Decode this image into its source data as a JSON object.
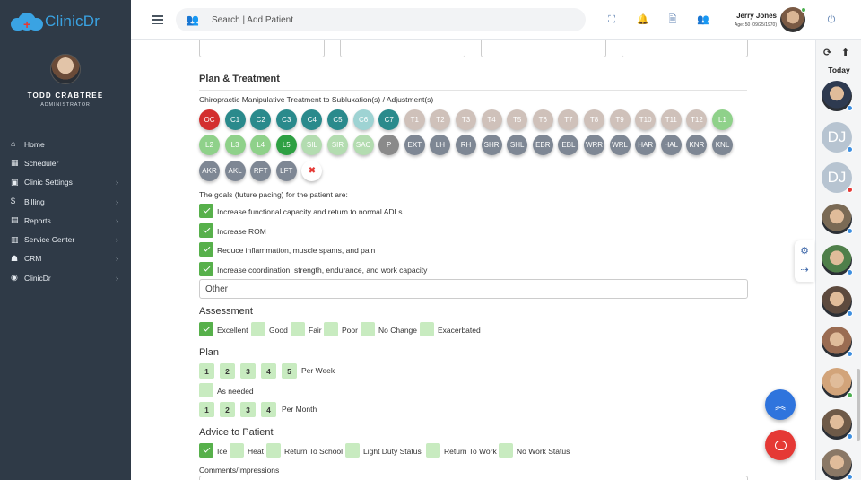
{
  "app": {
    "logo_text": "ClinicDr"
  },
  "profile": {
    "name": "TODD CRABTREE",
    "role": "ADMINISTRATOR"
  },
  "nav": [
    {
      "label": "Home",
      "icon": "home-icon",
      "chevron": false
    },
    {
      "label": "Scheduler",
      "icon": "calendar-icon",
      "chevron": false
    },
    {
      "label": "Clinic Settings",
      "icon": "settings-icon",
      "chevron": true
    },
    {
      "label": "Billing",
      "icon": "dollar-icon",
      "chevron": true
    },
    {
      "label": "Reports",
      "icon": "report-icon",
      "chevron": true
    },
    {
      "label": "Service Center",
      "icon": "service-icon",
      "chevron": true
    },
    {
      "label": "CRM",
      "icon": "crm-icon",
      "chevron": true
    },
    {
      "label": "ClinicDr",
      "icon": "clinicdr-icon",
      "chevron": true
    }
  ],
  "topbar": {
    "search_placeholder": "Search | Add Patient",
    "user_name": "Jerry Jones",
    "user_age": "Age: 50 (09/25/1970)"
  },
  "plan_treatment": {
    "title": "Plan & Treatment",
    "subtitle": "Chiropractic Manipulative Treatment to Subluxation(s) / Adjustment(s)",
    "segments_row1": [
      {
        "label": "OC",
        "color": "#d32f2f"
      },
      {
        "label": "C1",
        "color": "#2a8a8c"
      },
      {
        "label": "C2",
        "color": "#2a8a8c"
      },
      {
        "label": "C3",
        "color": "#2a8a8c"
      },
      {
        "label": "C4",
        "color": "#2a8a8c"
      },
      {
        "label": "C5",
        "color": "#2a8a8c"
      },
      {
        "label": "C6",
        "color": "#9ed3d3"
      },
      {
        "label": "C7",
        "color": "#2a8a8c"
      },
      {
        "label": "T1",
        "color": "#cfc1ba"
      },
      {
        "label": "T2",
        "color": "#cfc1ba"
      },
      {
        "label": "T3",
        "color": "#cfc1ba"
      },
      {
        "label": "T4",
        "color": "#cfc1ba"
      },
      {
        "label": "T5",
        "color": "#cfc1ba"
      },
      {
        "label": "T6",
        "color": "#cfc1ba"
      },
      {
        "label": "T7",
        "color": "#cfc1ba"
      },
      {
        "label": "T8",
        "color": "#cfc1ba"
      },
      {
        "label": "T9",
        "color": "#cfc1ba"
      },
      {
        "label": "T10",
        "color": "#cfc1ba"
      },
      {
        "label": "T11",
        "color": "#cfc1ba"
      },
      {
        "label": "T12",
        "color": "#cfc1ba"
      },
      {
        "label": "L1",
        "color": "#8fd18a"
      }
    ],
    "segments_row2": [
      {
        "label": "L2",
        "color": "#8fd18a"
      },
      {
        "label": "L3",
        "color": "#8fd18a"
      },
      {
        "label": "L4",
        "color": "#8fd18a"
      },
      {
        "label": "L5",
        "color": "#2ea043"
      },
      {
        "label": "SIL",
        "color": "#b3dcb0"
      },
      {
        "label": "SIR",
        "color": "#b3dcb0"
      },
      {
        "label": "SAC",
        "color": "#b3dcb0"
      },
      {
        "label": "P",
        "color": "#8a8a8a"
      },
      {
        "label": "EXT",
        "color": "#7e8794"
      },
      {
        "label": "LH",
        "color": "#7e8794"
      },
      {
        "label": "RH",
        "color": "#7e8794"
      },
      {
        "label": "SHR",
        "color": "#7e8794"
      },
      {
        "label": "SHL",
        "color": "#7e8794"
      },
      {
        "label": "EBR",
        "color": "#7e8794"
      },
      {
        "label": "EBL",
        "color": "#7e8794"
      },
      {
        "label": "WRR",
        "color": "#7e8794"
      },
      {
        "label": "WRL",
        "color": "#7e8794"
      },
      {
        "label": "HAR",
        "color": "#7e8794"
      },
      {
        "label": "HAL",
        "color": "#7e8794"
      },
      {
        "label": "KNR",
        "color": "#7e8794"
      },
      {
        "label": "KNL",
        "color": "#7e8794"
      }
    ],
    "segments_row3": [
      {
        "label": "AKR",
        "color": "#7e8794"
      },
      {
        "label": "AKL",
        "color": "#7e8794"
      },
      {
        "label": "RFT",
        "color": "#7e8794"
      },
      {
        "label": "LFT",
        "color": "#7e8794"
      }
    ],
    "clear_symbol": "✖",
    "goals_title": "The goals (future pacing) for the patient are:",
    "goals": [
      "Increase functional capacity and return to normal ADLs",
      "Increase ROM",
      "Reduce inflammation, muscle spams, and pain",
      "Increase coordination, strength, endurance, and work capacity"
    ],
    "other_placeholder": "Other"
  },
  "assessment": {
    "title": "Assessment",
    "options": [
      {
        "label": "Excellent",
        "checked": true
      },
      {
        "label": "Good",
        "checked": false
      },
      {
        "label": "Fair",
        "checked": false
      },
      {
        "label": "Poor",
        "checked": false
      },
      {
        "label": "No Change",
        "checked": false
      },
      {
        "label": "Exacerbated",
        "checked": false
      }
    ]
  },
  "plan": {
    "title": "Plan",
    "per_week_numbers": [
      "1",
      "2",
      "3",
      "4",
      "5"
    ],
    "per_week_label": "Per Week",
    "as_needed_label": "As needed",
    "per_month_numbers": [
      "1",
      "2",
      "3",
      "4"
    ],
    "per_month_label": "Per Month"
  },
  "advice": {
    "title": "Advice to Patient",
    "options": [
      {
        "label": "Ice",
        "checked": true
      },
      {
        "label": "Heat",
        "checked": false
      },
      {
        "label": "Return To School",
        "checked": false
      },
      {
        "label": "Light Duty Status",
        "checked": false
      },
      {
        "label": "Return To Work",
        "checked": false
      },
      {
        "label": "No Work Status",
        "checked": false
      }
    ]
  },
  "comments": {
    "label": "Comments/Impressions"
  },
  "rail": {
    "today_label": "Today",
    "patients": [
      {
        "type": "photo",
        "status": "#3d8fe0",
        "tone": "#2e3a50"
      },
      {
        "type": "initials",
        "initials": "DJ",
        "status": "#3d8fe0"
      },
      {
        "type": "initials",
        "initials": "DJ",
        "status": "#e53935"
      },
      {
        "type": "photo",
        "status": "#3d8fe0",
        "tone": "#7a6a55"
      },
      {
        "type": "photo",
        "status": "#3d8fe0",
        "tone": "#4f7f4a"
      },
      {
        "type": "photo",
        "status": "#3d8fe0",
        "tone": "#5d4a3e"
      },
      {
        "type": "photo",
        "status": "#3d8fe0",
        "tone": "#9a6c52"
      },
      {
        "type": "photo",
        "status": "#4caf50",
        "tone": "#d2a47a"
      },
      {
        "type": "photo",
        "status": "#3d8fe0",
        "tone": "#6e5a48"
      },
      {
        "type": "photo",
        "status": "#3d8fe0",
        "tone": "#8a7866"
      }
    ]
  },
  "colors": {
    "sidebar_bg": "#2f3a47",
    "accent_blue": "#2f74dd",
    "check_on": "#57b04b",
    "check_off": "#c8ebc0",
    "chat_red": "#e53935"
  }
}
